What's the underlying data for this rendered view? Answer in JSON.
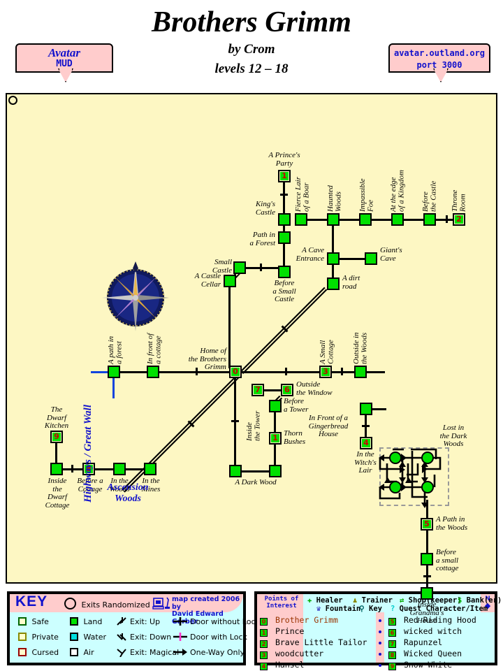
{
  "header": {
    "title": "Brothers Grimm",
    "byline": "by Crom",
    "levels": "levels 12 – 18",
    "banner_left_line1": "Avatar",
    "banner_left_line2": "MUD",
    "banner_right_line1": "avatar.outland.org",
    "banner_right_line2": "port 3000"
  },
  "map": {
    "area_label_highway": "Highways / Great Wall",
    "area_label_ascension": "Ascension\nWoods",
    "maze_label": "Lost in\nthe Dark\nWoods",
    "rooms": [
      {
        "id": "princes-party",
        "label": "A Prince's\nParty",
        "num": "1",
        "quest": true
      },
      {
        "id": "kings-castle",
        "label": "King's\nCastle",
        "num": ""
      },
      {
        "id": "path-in-a-forest",
        "label": "Path in\na Forest",
        "num": ""
      },
      {
        "id": "before-a-small-castle",
        "label": "Before\na Small\nCastle",
        "num": ""
      },
      {
        "id": "small-castle",
        "label": "Small\nCastle",
        "num": ""
      },
      {
        "id": "a-castle-cellar",
        "label": "A Castle\nCellar",
        "num": ""
      },
      {
        "id": "fierce-lair-of-a-boar",
        "label": "Fierce Lair\nof a Boar",
        "num": ""
      },
      {
        "id": "haunted-woods",
        "label": "Haunted\nWoods",
        "num": ""
      },
      {
        "id": "impassible-foe",
        "label": "Impassible\nFoe",
        "num": ""
      },
      {
        "id": "at-the-edge",
        "label": "At the edge\nof a Kingdom",
        "num": ""
      },
      {
        "id": "before-the-castle",
        "label": "Before\nthe Castle",
        "num": ""
      },
      {
        "id": "throne-room",
        "label": "Throne\nRoom",
        "num": "2",
        "quest": true
      },
      {
        "id": "a-cave-entrance",
        "label": "A Cave\nEntrance",
        "num": ""
      },
      {
        "id": "giants-cave",
        "label": "Giant's\nCave",
        "num": ""
      },
      {
        "id": "a-dirt-road",
        "label": "A dirt\nroad",
        "num": ""
      },
      {
        "id": "a-path-in-a-forest",
        "label": "A path in\na forest",
        "num": ""
      },
      {
        "id": "in-front-of-a-cottage",
        "label": "In front of\na cottage",
        "num": ""
      },
      {
        "id": "home-brothers-grimm",
        "label": "Home of\nthe Brothers\nGrimm",
        "num": "0",
        "quest": true
      },
      {
        "id": "a-small-cottage",
        "label": "A Small\nCottage",
        "num": "3",
        "quest": true
      },
      {
        "id": "outside-in-the-woods",
        "label": "Outside in\nthe Woods",
        "num": ""
      },
      {
        "id": "inside-the-tower",
        "label": "Inside\nthe Tower",
        "num": "7",
        "quest": true
      },
      {
        "id": "outside-the-window",
        "label": "Outside\nthe Window",
        "num": "6",
        "quest": true
      },
      {
        "id": "before-a-tower",
        "label": "Before\na Tower",
        "num": ""
      },
      {
        "id": "thorn-bushes",
        "label": "Thorn\nBushes",
        "num": "1",
        "quest": true
      },
      {
        "id": "a-dark-wood",
        "label": "A Dark Wood",
        "num": ""
      },
      {
        "id": "gingerbread-house",
        "label": "In Front of a\nGingerbread\nHouse",
        "num": ""
      },
      {
        "id": "in-the-witchs-lair",
        "label": "In the\nWitch's\nLair",
        "num": "4",
        "quest": true
      },
      {
        "id": "a-path-in-the-woods",
        "label": "A Path in\nthe Woods",
        "num": "5",
        "quest": true
      },
      {
        "id": "before-a-small-cottage",
        "label": "Before\na small\ncottage",
        "num": ""
      },
      {
        "id": "inside-grandmas-house",
        "label": "Inside\nGrandma's\nHouse",
        "num": ""
      },
      {
        "id": "the-dwarf-kitchen",
        "label": "The\nDwarf\nKitchen",
        "num": "9",
        "quest": true
      },
      {
        "id": "inside-dwarf-cottage",
        "label": "Inside\nthe\nDwarf\nCottage",
        "num": ""
      },
      {
        "id": "before-a-cottage",
        "label": "Before a\nCottage",
        "num": "8",
        "quest": true
      },
      {
        "id": "in-the-woods",
        "label": "In the\nWoods",
        "num": ""
      },
      {
        "id": "in-the-mines",
        "label": "In the\nMines",
        "num": ""
      }
    ]
  },
  "legend": {
    "key_title": "KEY",
    "exits_randomized": "Exits Randomized",
    "credit_line1": "map created 2006 by",
    "credit_line2": "David Edward Garber",
    "col1": [
      {
        "label": "Safe",
        "fill": "#ffffcc",
        "stroke": "#006600"
      },
      {
        "label": "Private",
        "fill": "#ffffcc",
        "stroke": "#888800"
      },
      {
        "label": "Cursed",
        "fill": "#ffffcc",
        "stroke": "#990000"
      }
    ],
    "col2": [
      {
        "label": "Land",
        "fill": "#00e000",
        "stroke": "#000000"
      },
      {
        "label": "Water",
        "fill": "#00e0e0",
        "stroke": "#000000"
      },
      {
        "label": "Air",
        "fill": "#ffffff",
        "stroke": "#000000"
      }
    ],
    "col3": [
      {
        "label": "Exit: Up"
      },
      {
        "label": "Exit: Down"
      },
      {
        "label": "Exit: Magical"
      }
    ],
    "col4": [
      {
        "label": "Door without Lock"
      },
      {
        "label": "Door with Lock"
      },
      {
        "label": "One-Way Only"
      }
    ]
  },
  "poi": {
    "title_line1": "Points of",
    "title_line2": "Interest",
    "icons_row1": [
      "Healer",
      "Trainer",
      "Shop(keeper)",
      "Bank(er)"
    ],
    "icons_row2": [
      "Fountain",
      "Key",
      "Quest Character/Item"
    ],
    "compass_n": "N",
    "left_list": [
      {
        "num": "0",
        "label": "Brother Grimm",
        "highlight": true
      },
      {
        "num": "1",
        "label": "Prince"
      },
      {
        "num": "2",
        "label": "Brave Little Tailor"
      },
      {
        "num": "3",
        "label": "woodcutter"
      },
      {
        "num": "4",
        "label": "Hansel"
      }
    ],
    "right_list": [
      {
        "num": "5",
        "label": "Red Riding Hood"
      },
      {
        "num": "6",
        "label": "wicked witch"
      },
      {
        "num": "7",
        "label": "Rapunzel"
      },
      {
        "num": "8",
        "label": "Wicked Queen"
      },
      {
        "num": "9",
        "label": "Snow White"
      }
    ]
  },
  "colors": {
    "parchment": "#fdf7c3",
    "room_green": "#00e000",
    "legend_bg": "#ccffff",
    "pink": "#ffcccc",
    "blue_text": "#1111cc",
    "quest_red": "#cc0000"
  }
}
